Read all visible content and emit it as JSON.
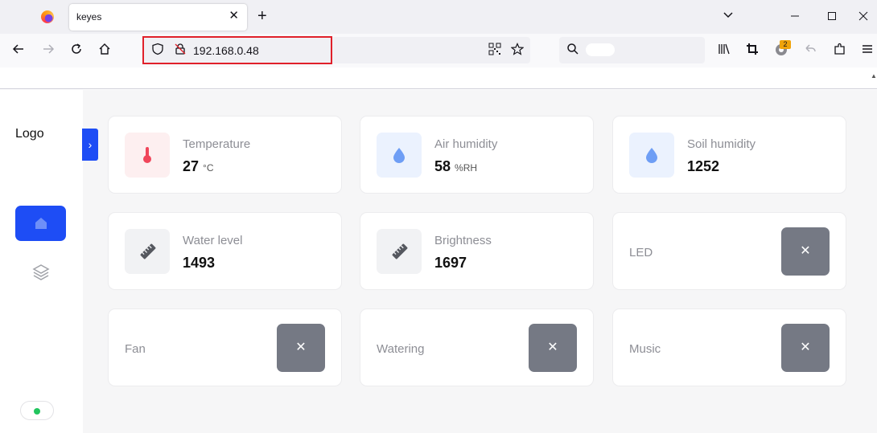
{
  "browser": {
    "tab_title": "keyes",
    "tab_close": "✕",
    "new_tab": "+",
    "url": "192.168.0.48",
    "extension_badge": "2"
  },
  "sidebar": {
    "logo": "Logo",
    "toggle_glyph": "›",
    "items": [
      {
        "icon": "home-icon",
        "active": true
      },
      {
        "icon": "layers-icon",
        "active": false
      }
    ],
    "status_color": "#22c55e"
  },
  "sensors": [
    {
      "label": "Temperature",
      "value": "27",
      "unit": "°C",
      "icon": "thermometer-icon",
      "icon_bg": "#fdeff0",
      "icon_color": "#f0455a"
    },
    {
      "label": "Air humidity",
      "value": "58",
      "unit": "%RH",
      "icon": "droplet-icon",
      "icon_bg": "#ebf2fe",
      "icon_color": "#6e9ef5"
    },
    {
      "label": "Soil humidity",
      "value": "1252",
      "unit": "",
      "icon": "droplet-icon",
      "icon_bg": "#ebf2fe",
      "icon_color": "#6e9ef5"
    },
    {
      "label": "Water level",
      "value": "1493",
      "unit": "",
      "icon": "ruler-icon",
      "icon_bg": "#f1f2f4",
      "icon_color": "#55585f"
    },
    {
      "label": "Brightness",
      "value": "1697",
      "unit": "",
      "icon": "ruler-icon",
      "icon_bg": "#f1f2f4",
      "icon_color": "#55585f"
    }
  ],
  "controls": [
    {
      "label": "LED",
      "state": "off",
      "glyph": "✕"
    },
    {
      "label": "Fan",
      "state": "off",
      "glyph": "✕"
    },
    {
      "label": "Watering",
      "state": "off",
      "glyph": "✕"
    },
    {
      "label": "Music",
      "state": "off",
      "glyph": "✕"
    }
  ],
  "colors": {
    "accent": "#1e4df5",
    "toggle_off": "#757984",
    "highlight": "#e0202a"
  }
}
